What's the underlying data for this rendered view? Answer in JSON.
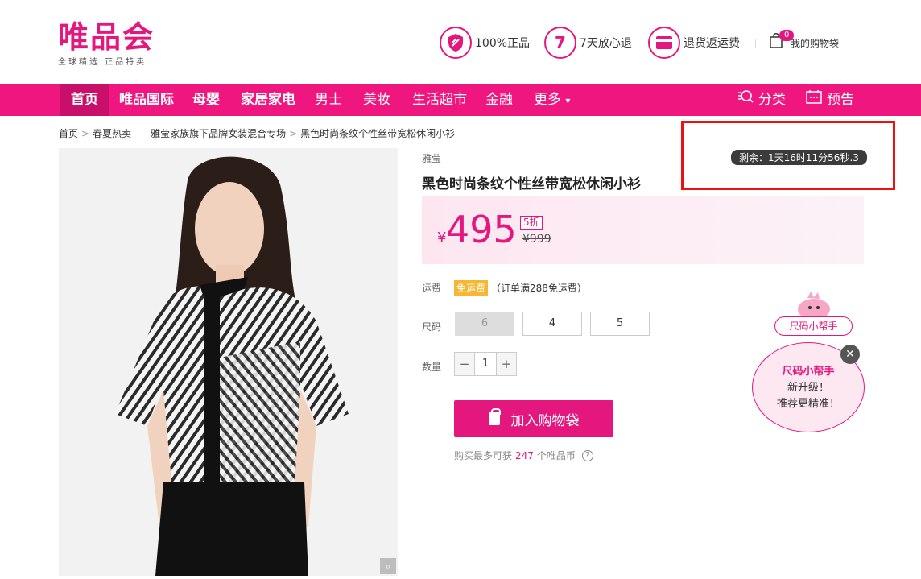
{
  "logo": {
    "main": "唯品会",
    "sub": "全球精选 正品特卖"
  },
  "promises": [
    {
      "icon": "shield-icon",
      "label": "100%正品"
    },
    {
      "icon": "seven-day-icon",
      "label": "7天放心退",
      "glyph": "7"
    },
    {
      "icon": "card-icon",
      "label": "退货返运费"
    }
  ],
  "cart": {
    "count": "0",
    "label": "我的购物袋"
  },
  "nav": {
    "items": [
      "首页",
      "唯品国际",
      "母婴",
      "家居家电",
      "男士",
      "美妆",
      "生活超市",
      "金融",
      "更多"
    ],
    "more_arrow": "▾",
    "category": "分类",
    "preview": "预告"
  },
  "breadcrumb": [
    "首页",
    "春夏热卖——雅莹家族旗下品牌女装混合专场",
    "黑色时尚条纹个性丝带宽松休闲小衫"
  ],
  "breadcrumb_sep": ">",
  "product": {
    "brand": "雅莹",
    "title": "黑色时尚条纹个性丝带宽松休闲小衫",
    "countdown": "剩余：1天16时11分56秒.3",
    "currency": "¥",
    "price": "495",
    "discount": "5折",
    "original_price": "¥999",
    "shipping_label": "运费",
    "shipping_tag": "免运费",
    "shipping_note": "（订单满288免运费）",
    "size_label": "尺码",
    "sizes": [
      {
        "value": "6",
        "disabled": true
      },
      {
        "value": "4",
        "disabled": false
      },
      {
        "value": "5",
        "disabled": false
      }
    ],
    "quantity_label": "数量",
    "quantity": "1",
    "minus": "−",
    "plus": "+",
    "add_to_cart": "加入购物袋",
    "coins_prefix": "购买最多可获",
    "coins": "247",
    "coins_suffix": "个唯品币",
    "help_glyph": "?"
  },
  "helper": {
    "tag": "尺码小帮手",
    "title": "尺码小帮手",
    "line1": "新升级！",
    "line2": "推荐更精准！",
    "close": "✕"
  },
  "zoom_glyph": "⌕",
  "colors": {
    "brand": "#e4177f",
    "nav": "#f0167f",
    "highlight": "#e11111"
  }
}
